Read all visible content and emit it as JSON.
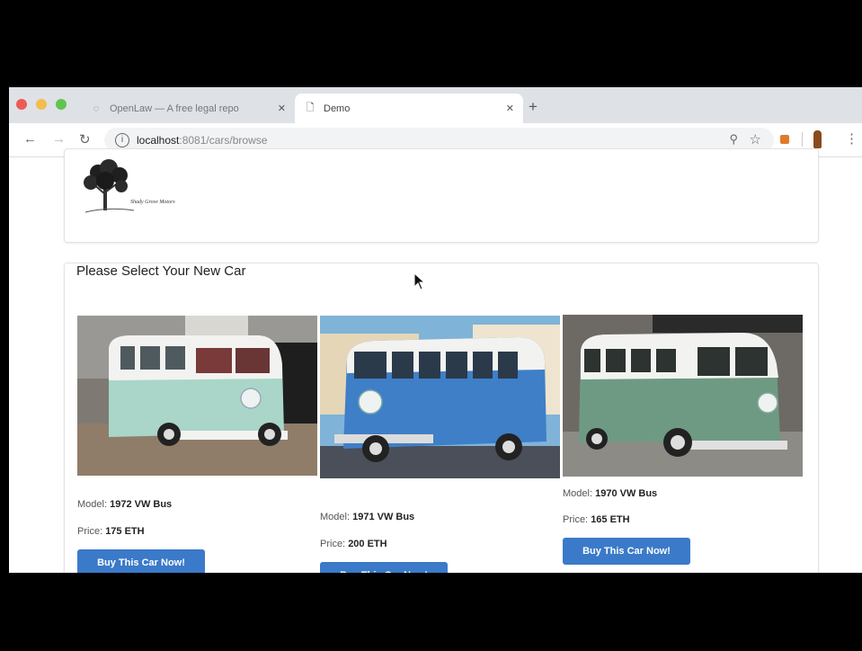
{
  "browser": {
    "tabs": [
      {
        "title": "OpenLaw — A free legal repo",
        "active": false
      },
      {
        "title": "Demo",
        "active": true
      }
    ],
    "url_host": "localhost",
    "url_path": ":8081/cars/browse"
  },
  "logo_text": "Shady Grove Motors",
  "section_title": "Please Select Your New Car",
  "model_label": "Model:",
  "price_label": "Price:",
  "cars": [
    {
      "model": "1972 VW Bus",
      "price": "175 ETH",
      "button": "Buy This Car Now!"
    },
    {
      "model": "1971 VW Bus",
      "price": "200 ETH",
      "button": "Buy This Car Now!"
    },
    {
      "model": "1970 VW Bus",
      "price": "165 ETH",
      "button": "Buy This Car Now!"
    }
  ],
  "colors": {
    "button": "#3a7ac9",
    "car1_body": "#a9d6c8",
    "car2_body": "#3f7fc7",
    "car3_body": "#6e9a84"
  }
}
